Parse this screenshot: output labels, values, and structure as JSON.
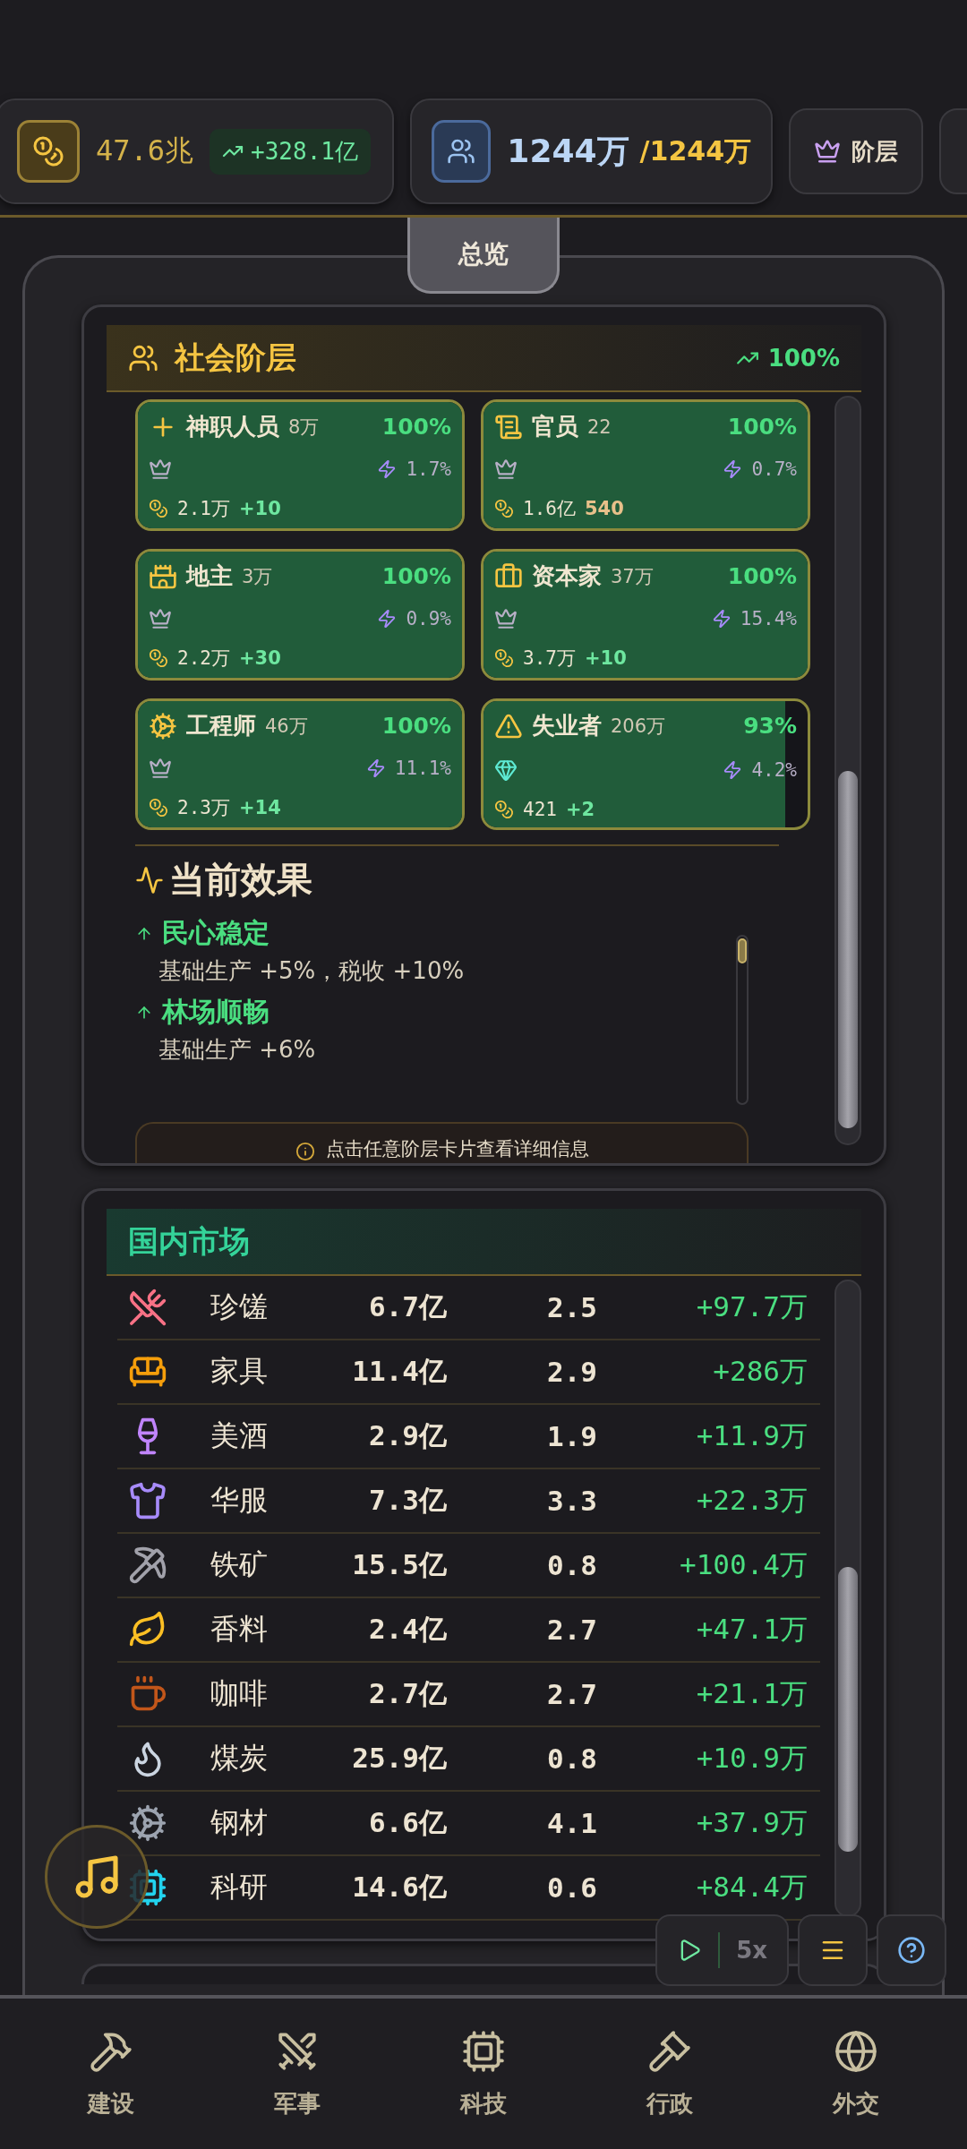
{
  "top_bar": {
    "treasury": {
      "value": "47.6兆",
      "rate": "+328.1亿"
    },
    "population": {
      "value": "1244万",
      "capacity": "/1244万"
    },
    "strata_button": "阶层"
  },
  "tabs": [
    {
      "label": "总览",
      "selected": true
    }
  ],
  "social_classes": {
    "title": "社会阶层",
    "approval": "100%",
    "classes": [
      {
        "kind": "clergy",
        "name": "神职人员",
        "count": "8万",
        "approval": "100%",
        "level": 1,
        "gem_badge": false,
        "influence": "1.7%",
        "income": "2.1万",
        "delta": "+10",
        "delta_positive": true
      },
      {
        "kind": "official",
        "name": "官员",
        "count": "22",
        "approval": "100%",
        "level": 1,
        "gem_badge": false,
        "influence": "0.7%",
        "income": "1.6亿",
        "delta": "540",
        "delta_positive": false
      },
      {
        "kind": "landlord",
        "name": "地主",
        "count": "3万",
        "approval": "100%",
        "level": 1,
        "gem_badge": false,
        "influence": "0.9%",
        "income": "2.2万",
        "delta": "+30",
        "delta_positive": true
      },
      {
        "kind": "capitalist",
        "name": "资本家",
        "count": "37万",
        "approval": "100%",
        "level": 1,
        "gem_badge": false,
        "influence": "15.4%",
        "income": "3.7万",
        "delta": "+10",
        "delta_positive": true
      },
      {
        "kind": "engineer",
        "name": "工程师",
        "count": "46万",
        "approval": "100%",
        "level": 1,
        "gem_badge": false,
        "influence": "11.1%",
        "income": "2.3万",
        "delta": "+14",
        "delta_positive": true
      },
      {
        "kind": "unemployed",
        "name": "失业者",
        "count": "206万",
        "approval": "93%",
        "level": 0.93,
        "gem_badge": true,
        "influence": "4.2%",
        "income": "421",
        "delta": "+2",
        "delta_positive": true
      }
    ],
    "effects_title": "当前效果",
    "effects": [
      {
        "name": "民心稳定",
        "description": "基础生产 +5%，税收 +10%"
      },
      {
        "name": "林场顺畅",
        "description": "基础生产 +6%"
      }
    ],
    "hint": "点击任意阶层卡片查看详细信息"
  },
  "market": {
    "title": "国内市场",
    "rows": [
      {
        "kind": "cutlery",
        "color": "#f87185",
        "name": "珍馐",
        "stock": "6.7亿",
        "price": "2.5",
        "change": "+97.7万"
      },
      {
        "kind": "sofa",
        "color": "#f59e0b",
        "name": "家具",
        "stock": "11.4亿",
        "price": "2.9",
        "change": "+286万"
      },
      {
        "kind": "wine",
        "color": "#c084fc",
        "name": "美酒",
        "stock": "2.9亿",
        "price": "1.9",
        "change": "+11.9万"
      },
      {
        "kind": "shirt",
        "color": "#a78bfa",
        "name": "华服",
        "stock": "7.3亿",
        "price": "3.3",
        "change": "+22.3万"
      },
      {
        "kind": "pickaxe",
        "color": "#a1a1aa",
        "name": "铁矿",
        "stock": "15.5亿",
        "price": "0.8",
        "change": "+100.4万"
      },
      {
        "kind": "leaf",
        "color": "#fbbf24",
        "name": "香料",
        "stock": "2.4亿",
        "price": "2.7",
        "change": "+47.1万"
      },
      {
        "kind": "cup",
        "color": "#c2561a",
        "name": "咖啡",
        "stock": "2.7亿",
        "price": "2.7",
        "change": "+21.1万"
      },
      {
        "kind": "flame",
        "color": "#cbd5e1",
        "name": "煤炭",
        "stock": "25.9亿",
        "price": "0.8",
        "change": "+10.9万"
      },
      {
        "kind": "gear",
        "color": "#9ca3af",
        "name": "钢材",
        "stock": "6.6亿",
        "price": "4.1",
        "change": "+37.9万"
      },
      {
        "kind": "chip",
        "color": "#22d3ee",
        "name": "科研",
        "stock": "14.6亿",
        "price": "0.6",
        "change": "+84.4万"
      }
    ]
  },
  "controls": {
    "speed": "5x"
  },
  "nav": [
    {
      "kind": "hammer",
      "label": "建设",
      "selected": false
    },
    {
      "kind": "swords",
      "label": "军事",
      "selected": false
    },
    {
      "kind": "chip",
      "label": "科技",
      "selected": false
    },
    {
      "kind": "gavel",
      "label": "行政",
      "selected": false
    },
    {
      "kind": "globe",
      "label": "外交",
      "selected": false
    }
  ]
}
